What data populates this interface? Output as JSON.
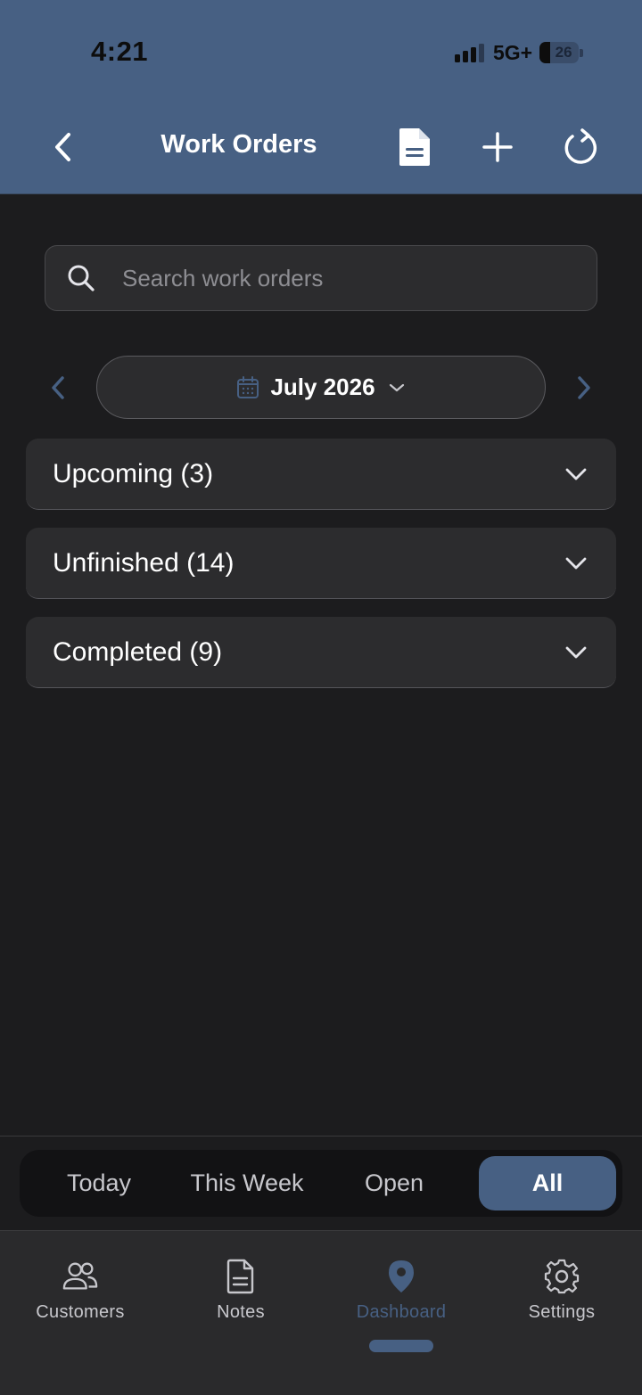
{
  "status_bar": {
    "time": "4:21",
    "network": "5G+",
    "battery": "26",
    "battery_level_percent": 26
  },
  "nav": {
    "title": "Work Orders",
    "icons": [
      "back-chevron-icon",
      "document-icon",
      "plus-icon",
      "refresh-icon"
    ]
  },
  "search": {
    "placeholder": "Search work orders",
    "value": ""
  },
  "month_selector": {
    "label": "July 2026"
  },
  "sections": [
    {
      "label": "Upcoming (3)"
    },
    {
      "label": "Unfinished (14)"
    },
    {
      "label": "Completed (9)"
    }
  ],
  "filter": {
    "options": [
      "Today",
      "This Week",
      "Open",
      "All"
    ],
    "selected": "All"
  },
  "tabbar": {
    "items": [
      {
        "label": "Customers",
        "icon": "people-icon"
      },
      {
        "label": "Notes",
        "icon": "note-icon"
      },
      {
        "label": "Dashboard",
        "icon": "location-pin-icon"
      },
      {
        "label": "Settings",
        "icon": "gear-icon"
      }
    ],
    "active": "Dashboard"
  },
  "colors": {
    "accent": "#476083",
    "background": "#1c1c1e",
    "card": "#2c2c2e",
    "text": "#ffffff",
    "muted": "#8e8e93"
  }
}
